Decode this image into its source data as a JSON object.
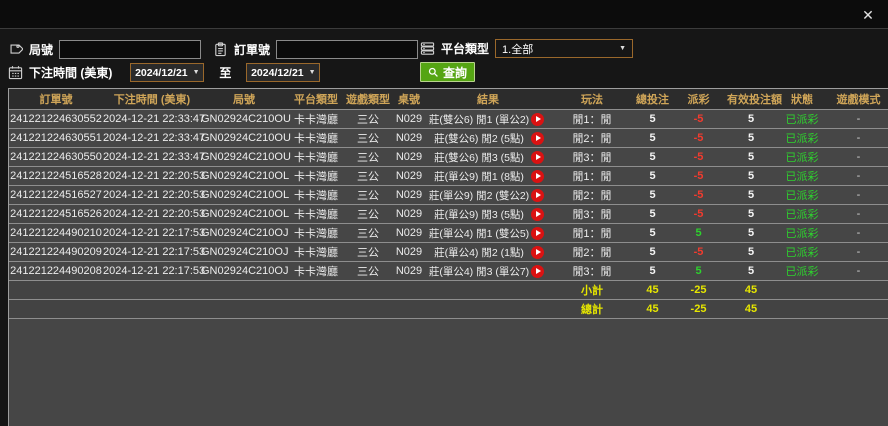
{
  "window": {
    "close_icon": "✕"
  },
  "filters": {
    "round_label": "局號",
    "round_value": "",
    "order_label": "訂單號",
    "order_value": "",
    "platform_label": "平台類型",
    "platform_value": "1.全部",
    "time_label": "下注時間 (美東)",
    "date_from": "2024/12/21",
    "to_label": "至",
    "date_to": "2024/12/21",
    "search_label": "查詢",
    "dropdown_arrow": "▼"
  },
  "table": {
    "columns": [
      "訂單號",
      "下注時間 (美東)",
      "局號",
      "平台類型",
      "遊戲類型",
      "桌號",
      "結果",
      "玩法",
      "總投注",
      "派彩",
      "有效投注額",
      "狀態",
      "遊戲模式"
    ],
    "rows": [
      {
        "order_id": "241221224630552",
        "time": "2024-12-21 22:33:47",
        "round_id": "GN02924C210OU",
        "platform": "卡卡灣廳",
        "game_type": "三公",
        "table_no": "N029",
        "result": "莊(雙公6) 閒1 (單公2)",
        "play": "閒1：閒",
        "total_bet": "5",
        "payout": "-5",
        "valid_bet": "5",
        "status": "已派彩",
        "mode": "-"
      },
      {
        "order_id": "241221224630551",
        "time": "2024-12-21 22:33:47",
        "round_id": "GN02924C210OU",
        "platform": "卡卡灣廳",
        "game_type": "三公",
        "table_no": "N029",
        "result": "莊(雙公6) 閒2 (5點)",
        "play": "閒2：閒",
        "total_bet": "5",
        "payout": "-5",
        "valid_bet": "5",
        "status": "已派彩",
        "mode": "-"
      },
      {
        "order_id": "241221224630550",
        "time": "2024-12-21 22:33:47",
        "round_id": "GN02924C210OU",
        "platform": "卡卡灣廳",
        "game_type": "三公",
        "table_no": "N029",
        "result": "莊(雙公6) 閒3 (5點)",
        "play": "閒3：閒",
        "total_bet": "5",
        "payout": "-5",
        "valid_bet": "5",
        "status": "已派彩",
        "mode": "-"
      },
      {
        "order_id": "241221224516528",
        "time": "2024-12-21 22:20:53",
        "round_id": "GN02924C210OL",
        "platform": "卡卡灣廳",
        "game_type": "三公",
        "table_no": "N029",
        "result": "莊(單公9) 閒1 (8點)",
        "play": "閒1：閒",
        "total_bet": "5",
        "payout": "-5",
        "valid_bet": "5",
        "status": "已派彩",
        "mode": "-"
      },
      {
        "order_id": "241221224516527",
        "time": "2024-12-21 22:20:53",
        "round_id": "GN02924C210OL",
        "platform": "卡卡灣廳",
        "game_type": "三公",
        "table_no": "N029",
        "result": "莊(單公9) 閒2 (雙公2)",
        "play": "閒2：閒",
        "total_bet": "5",
        "payout": "-5",
        "valid_bet": "5",
        "status": "已派彩",
        "mode": "-"
      },
      {
        "order_id": "241221224516526",
        "time": "2024-12-21 22:20:53",
        "round_id": "GN02924C210OL",
        "platform": "卡卡灣廳",
        "game_type": "三公",
        "table_no": "N029",
        "result": "莊(單公9) 閒3 (5點)",
        "play": "閒3：閒",
        "total_bet": "5",
        "payout": "-5",
        "valid_bet": "5",
        "status": "已派彩",
        "mode": "-"
      },
      {
        "order_id": "241221224490210",
        "time": "2024-12-21 22:17:53",
        "round_id": "GN02924C210OJ",
        "platform": "卡卡灣廳",
        "game_type": "三公",
        "table_no": "N029",
        "result": "莊(單公4) 閒1 (雙公5)",
        "play": "閒1：閒",
        "total_bet": "5",
        "payout": "5",
        "valid_bet": "5",
        "status": "已派彩",
        "mode": "-"
      },
      {
        "order_id": "241221224490209",
        "time": "2024-12-21 22:17:53",
        "round_id": "GN02924C210OJ",
        "platform": "卡卡灣廳",
        "game_type": "三公",
        "table_no": "N029",
        "result": "莊(單公4) 閒2 (1點)",
        "play": "閒2：閒",
        "total_bet": "5",
        "payout": "-5",
        "valid_bet": "5",
        "status": "已派彩",
        "mode": "-"
      },
      {
        "order_id": "241221224490208",
        "time": "2024-12-21 22:17:53",
        "round_id": "GN02924C210OJ",
        "platform": "卡卡灣廳",
        "game_type": "三公",
        "table_no": "N029",
        "result": "莊(單公4) 閒3 (單公7)",
        "play": "閒3：閒",
        "total_bet": "5",
        "payout": "5",
        "valid_bet": "5",
        "status": "已派彩",
        "mode": "-"
      }
    ],
    "subtotal": {
      "label": "小計",
      "total_bet": "45",
      "payout": "-25",
      "valid_bet": "45"
    },
    "total": {
      "label": "總計",
      "total_bet": "45",
      "payout": "-25",
      "valid_bet": "45"
    }
  },
  "colors": {
    "header_gold": "#cfa558",
    "positive_green": "#2ed12e",
    "negative_red": "#f23b2e",
    "summary_yellow": "#e6e600",
    "query_button_green": "#55a513",
    "date_border_brown": "#9a682b",
    "play_button_red": "#da1212",
    "row_background": "#464646",
    "header_background": "#2c2c2c"
  }
}
